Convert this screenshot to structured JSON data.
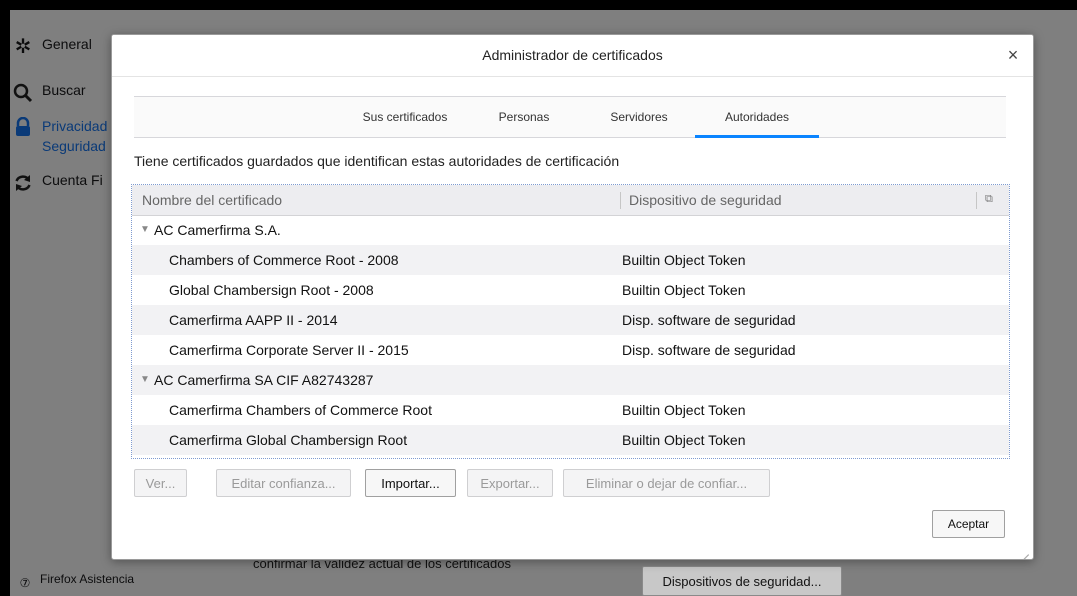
{
  "background": {
    "sidebar": [
      {
        "label": "General",
        "icon": "gear-icon"
      },
      {
        "label": "Buscar",
        "icon": "search-icon"
      },
      {
        "label": "Privacidad\nSeguridad",
        "icon": "lock-icon"
      },
      {
        "label": "Cuenta Fi",
        "icon": "sync-icon"
      }
    ],
    "help_label": "Firefox Asistencia",
    "obscured_text": "confirmar la validez actual de los certificados",
    "devices_button": "Dispositivos de seguridad..."
  },
  "dialog": {
    "title": "Administrador de certificados",
    "close": "×",
    "tabs": [
      "Sus certificados",
      "Personas",
      "Servidores",
      "Autoridades"
    ],
    "active_tab": "Autoridades",
    "description": "Tiene certificados guardados que identifican estas autoridades de certificación",
    "columns": {
      "name": "Nombre del certificado",
      "device": "Dispositivo de seguridad",
      "picker": "⧉"
    },
    "rows": [
      {
        "type": "group",
        "name": "AC Camerfirma S.A.",
        "device": ""
      },
      {
        "type": "child",
        "name": "Chambers of Commerce Root - 2008",
        "device": "Builtin Object Token"
      },
      {
        "type": "child",
        "name": "Global Chambersign Root - 2008",
        "device": "Builtin Object Token"
      },
      {
        "type": "child",
        "name": "Camerfirma AAPP II - 2014",
        "device": "Disp. software de seguridad"
      },
      {
        "type": "child",
        "name": "Camerfirma Corporate Server II - 2015",
        "device": "Disp. software de seguridad"
      },
      {
        "type": "group",
        "name": "AC Camerfirma SA CIF A82743287",
        "device": ""
      },
      {
        "type": "child",
        "name": "Camerfirma Chambers of Commerce Root",
        "device": "Builtin Object Token"
      },
      {
        "type": "child",
        "name": "Camerfirma Global Chambersign Root",
        "device": "Builtin Object Token"
      }
    ],
    "buttons": {
      "view": "Ver...",
      "edit": "Editar confianza...",
      "import": "Importar...",
      "export": "Exportar...",
      "delete": "Eliminar o dejar de confiar...",
      "ok": "Aceptar"
    }
  }
}
